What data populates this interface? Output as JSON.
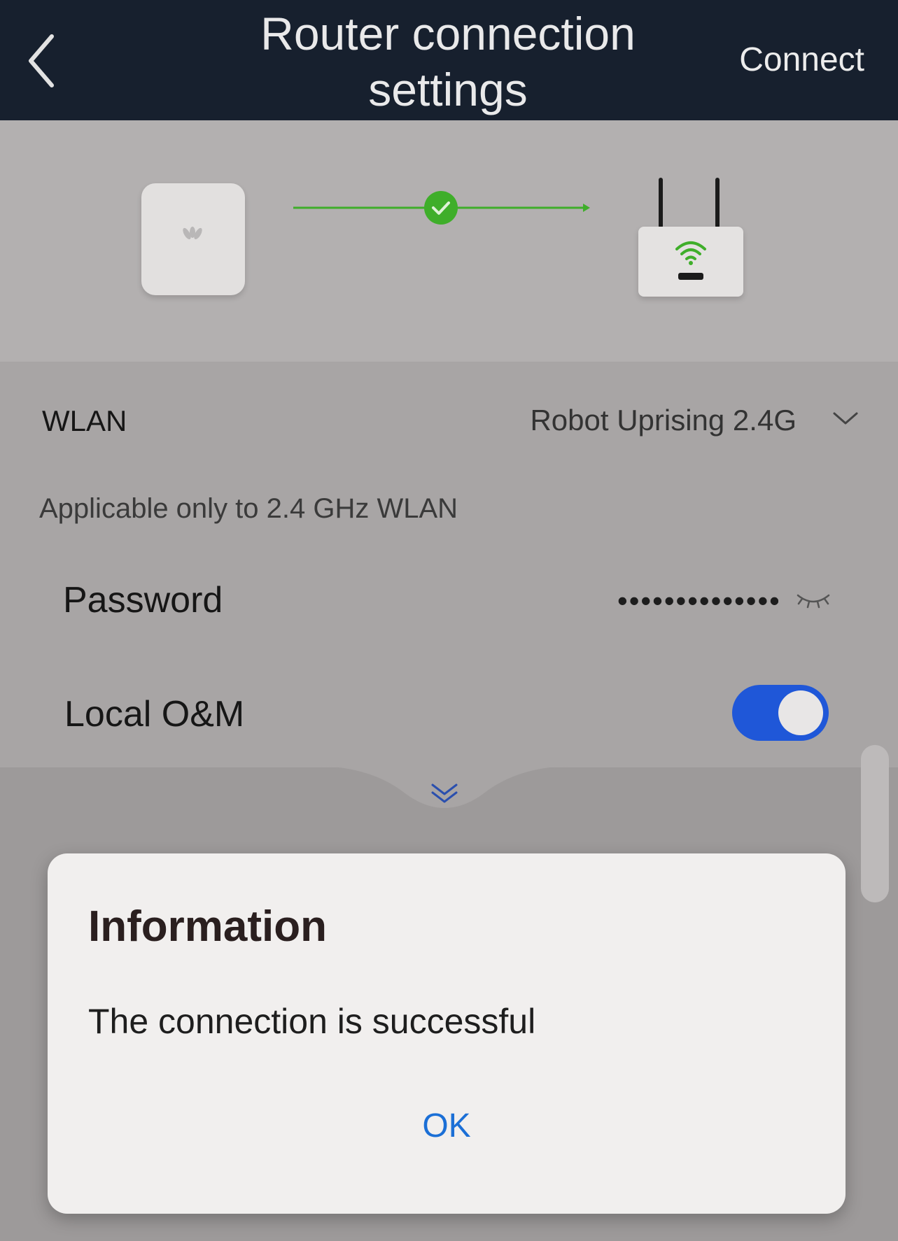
{
  "header": {
    "title": "Router connection settings",
    "connect_label": "Connect"
  },
  "settings": {
    "wlan_label": "WLAN",
    "wlan_value": "Robot Uprising 2.4G",
    "wlan_note": "Applicable only to 2.4 GHz WLAN",
    "password_label": "Password",
    "password_value": "••••••••••••••",
    "local_om_label": "Local O&M",
    "local_om_enabled": true
  },
  "dialog": {
    "title": "Information",
    "message": "The connection is successful",
    "ok_label": "OK"
  },
  "colors": {
    "header_bg": "#17202e",
    "toggle_on": "#1f57d8",
    "ok_text": "#1b6fd6",
    "connection_success": "#3fae2a"
  },
  "icons": [
    "back-chevron-icon",
    "inverter-icon",
    "check-circle-icon",
    "router-icon",
    "wifi-icon",
    "chevron-down-icon",
    "eye-closed-icon",
    "double-chevron-down-icon"
  ]
}
